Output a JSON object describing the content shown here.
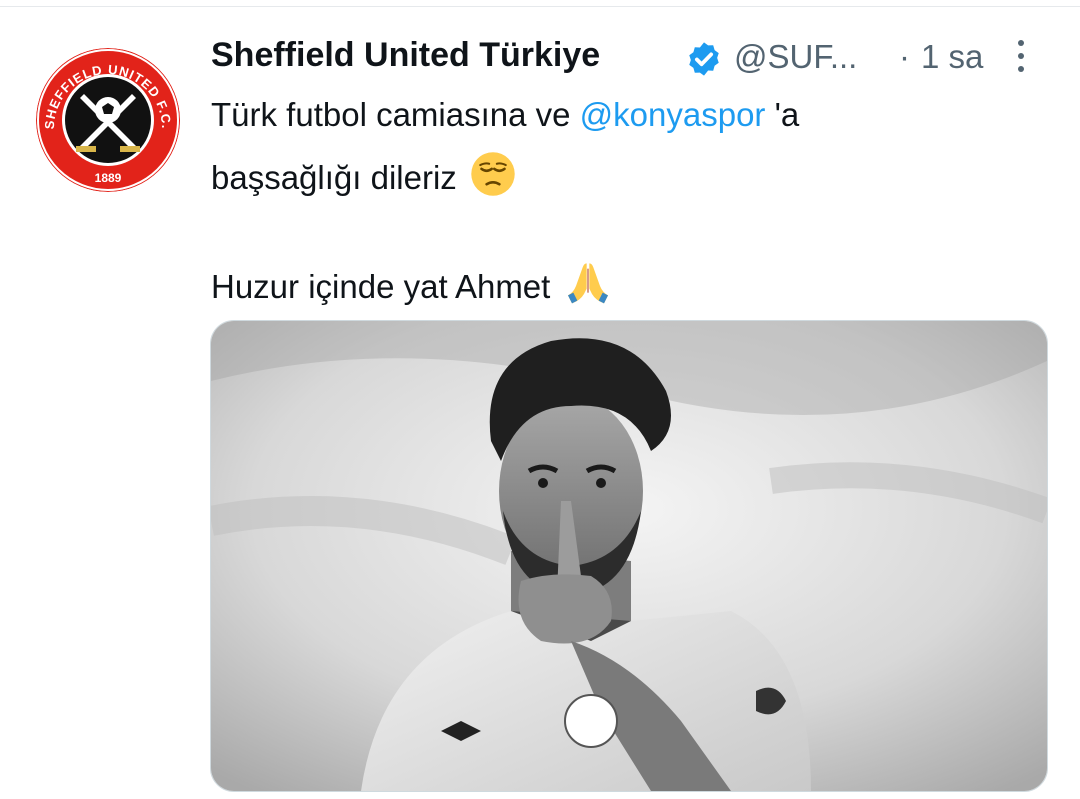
{
  "tweet": {
    "display_name": "Sheffield United Türkiye",
    "handle": "@SUF...",
    "separator": "·",
    "time": "1 sa",
    "text_line1_before": "Türk futbol camiasına ve ",
    "mention": "@konyaspor",
    "text_line1_after": " 'a",
    "text_line2": "başsağlığı dileriz",
    "text_line3": "Huzur içinde yat Ahmet",
    "avatar_logo_text": "SHEFFIELD UNITED F.C.",
    "avatar_year": "1889"
  },
  "icons": {
    "verified": "verified-badge-icon",
    "more": "more-options-icon",
    "emoji_pensive": "pensive-face-emoji",
    "emoji_pray": "folded-hands-emoji"
  },
  "colors": {
    "text": "#0f1419",
    "secondary": "#536471",
    "link": "#1d9bf0",
    "verified": "#1d9bf0",
    "crest_red": "#e2231a"
  }
}
